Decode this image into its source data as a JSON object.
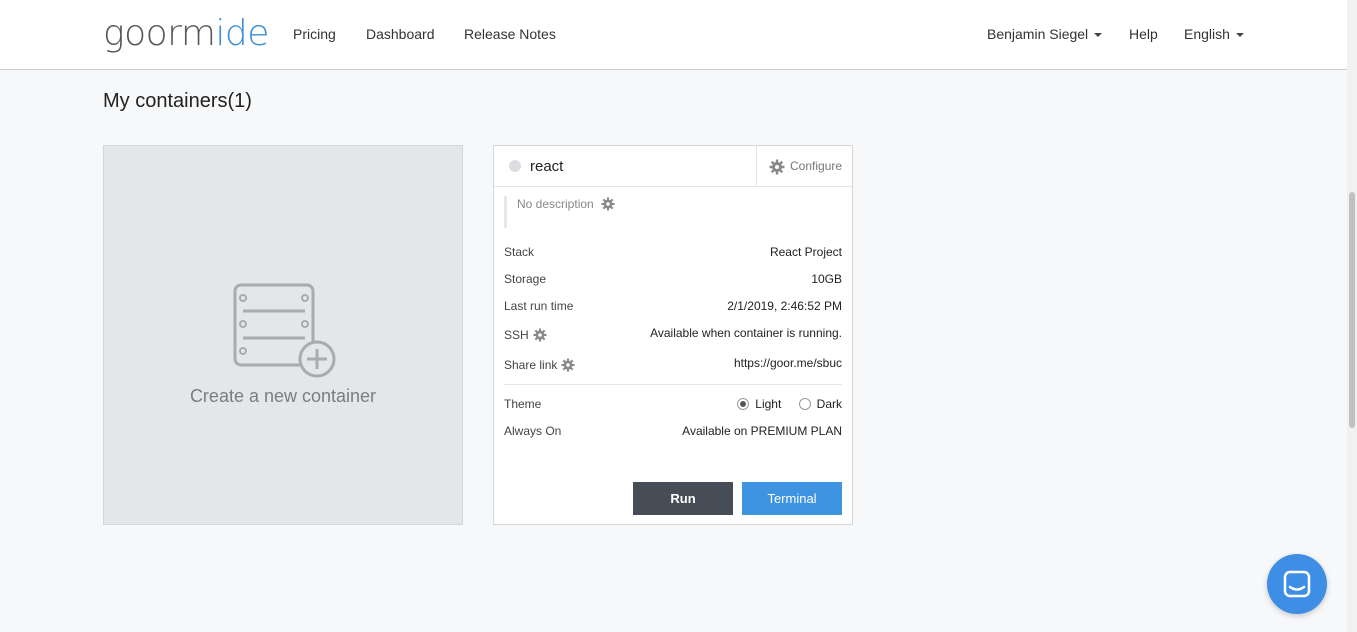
{
  "header": {
    "logo_main": "goorm",
    "logo_accent": "ide",
    "nav": [
      "Pricing",
      "Dashboard",
      "Release Notes"
    ],
    "user_name": "Benjamin Siegel",
    "help": "Help",
    "language": "English"
  },
  "page_title": "My containers(1)",
  "create_card": {
    "label": "Create a new container",
    "icon": "server-add-icon"
  },
  "container": {
    "name": "react",
    "configure": "Configure",
    "description": "No description",
    "rows": {
      "stack": {
        "label": "Stack",
        "value": "React Project"
      },
      "storage": {
        "label": "Storage",
        "value": "10GB"
      },
      "last_run": {
        "label": "Last run time",
        "value": "2/1/2019, 2:46:52 PM"
      },
      "ssh": {
        "label": "SSH",
        "value": "Available when container is running."
      },
      "share": {
        "label": "Share link",
        "value": "https://goor.me/sbuc"
      },
      "theme": {
        "label": "Theme",
        "options": [
          "Light",
          "Dark"
        ],
        "selected": "Light"
      },
      "always_on": {
        "label": "Always On",
        "value": "Available on PREMIUM PLAN"
      }
    },
    "run_button": "Run",
    "terminal_button": "Terminal"
  },
  "colors": {
    "accent": "#3e94e0",
    "run_button": "#474d57",
    "background": "#f7f8fa"
  }
}
